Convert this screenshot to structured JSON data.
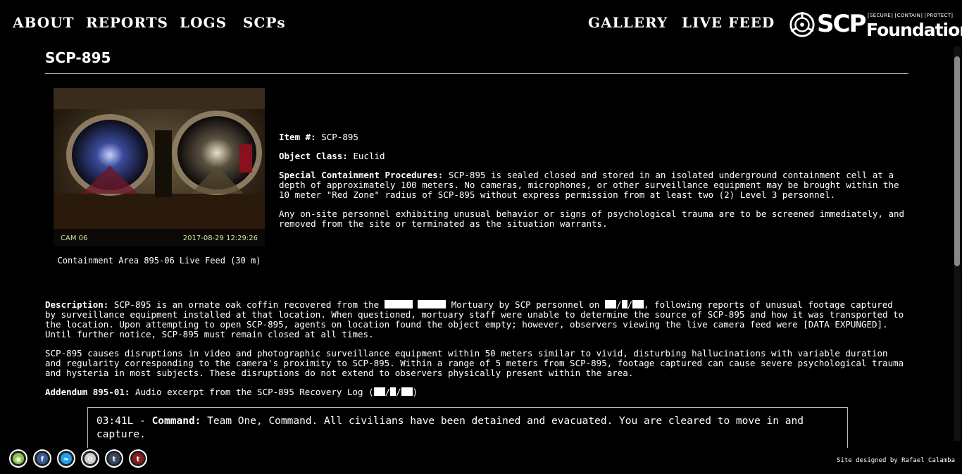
{
  "nav": {
    "left": [
      "ABOUT",
      "REPORTS",
      "LOGS",
      "SCPs"
    ],
    "right": [
      "GALLERY",
      "LIVE FEED"
    ]
  },
  "logo": {
    "main": "SCP",
    "sub": "Foundation",
    "tagline": "[SECURE] [CONTAIN] [PROTECT]"
  },
  "page": {
    "title": "SCP-895"
  },
  "feed": {
    "cam": "CAM 06",
    "timestamp": "2017-08-29 12:29:26",
    "caption": "Containment Area 895-06 Live Feed (30 m)"
  },
  "info": {
    "item_label": "Item #:",
    "item_value": "SCP-895",
    "class_label": "Object Class:",
    "class_value": "Euclid",
    "procedures_label": "Special Containment Procedures:",
    "procedures_text": "SCP-895 is sealed closed and stored in an isolated underground containment cell at a depth of approximately 100 meters. No cameras, microphones, or other surveillance equipment may be brought within the 10 meter \"Red Zone\" radius of SCP-895 without express permission from at least two (2) Level 3 personnel.",
    "procedures_text2": "Any on-site personnel exhibiting unusual behavior or signs of psychological trauma are to be screened immediately, and removed from the site or terminated as the situation warrants."
  },
  "description": {
    "label": "Description:",
    "p1_a": "SCP-895 is an ornate oak coffin recovered from the",
    "p1_b": "Mortuary by SCP personnel on",
    "p1_c": ", following reports of unusual footage captured by surveillance equipment installed at that location. When questioned, mortuary staff were unable to determine the source of SCP-895 and how it was transported to the location. Upon attempting to open SCP-895, agents on location found the object empty; however, observers viewing the live camera feed were [DATA EXPUNGED]. Until further notice, SCP-895 must remain closed at all times.",
    "p2": "SCP-895 causes disruptions in video and photographic surveillance equipment within 50 meters similar to vivid, disturbing hallucinations with variable duration and regularity corresponding to the camera's proximity to SCP-895. Within a range of 5 meters from SCP-895, footage captured can cause severe psychological trauma and hysteria in most subjects. These disruptions do not extend to observers physically present within the area."
  },
  "addendum": {
    "label": "Addendum 895-01:",
    "text": "Audio excerpt from the SCP-895 Recovery Log ("
  },
  "log": {
    "time": "03:41L - ",
    "speaker": "Command:",
    "text": "Team One, Command. All civilians have been detained and evacuated. You are cleared to move in and capture."
  },
  "footer": {
    "credit": "Site designed by Rafael Calamba",
    "icons": [
      {
        "name": "camera-icon",
        "color": "#8bc34a"
      },
      {
        "name": "facebook-icon",
        "color": "#3b5998"
      },
      {
        "name": "twitter-icon",
        "color": "#1da1f2"
      },
      {
        "name": "scp-seal-icon",
        "color": "#cccccc"
      },
      {
        "name": "tumblr-icon",
        "color": "#35465c"
      },
      {
        "name": "tumblr-alt-icon",
        "color": "#8b1a1a"
      }
    ]
  }
}
